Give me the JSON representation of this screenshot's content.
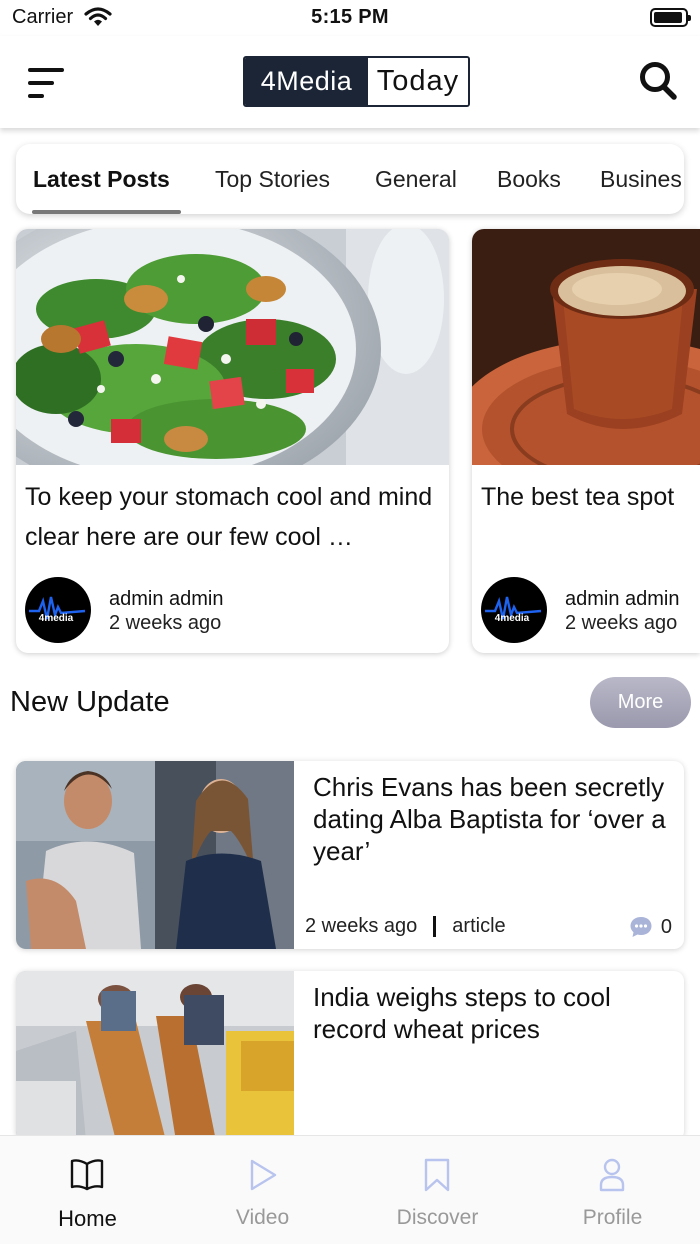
{
  "status": {
    "carrier": "Carrier",
    "time": "5:15 PM"
  },
  "header": {
    "logo_left": "4Media",
    "logo_right": "Today",
    "icons": [
      "menu-icon",
      "search-icon"
    ]
  },
  "tabs": [
    {
      "label": "Latest Posts",
      "active": true
    },
    {
      "label": "Top Stories"
    },
    {
      "label": "General"
    },
    {
      "label": "Books"
    },
    {
      "label": "Busines"
    }
  ],
  "featured": [
    {
      "title": "To keep your stomach cool and mind clear here are our few cool …",
      "author": "admin admin",
      "time": "2 weeks ago",
      "avatar_text": "4media",
      "image": "salad-photo"
    },
    {
      "title": "The best tea spot",
      "author": "admin admin",
      "time": "2 weeks ago",
      "avatar_text": "4media",
      "image": "tea-cup-photo"
    }
  ],
  "section": {
    "title": "New Update",
    "more_label": "More"
  },
  "updates": [
    {
      "title": "Chris Evans has been secretly dating Alba Baptista for ‘over a year’",
      "time": "2 weeks ago",
      "type": "article",
      "comments": "0",
      "image": "couple-photo"
    },
    {
      "title": "India weighs steps to cool record wheat prices",
      "image": "wheat-photo"
    }
  ],
  "nav": [
    {
      "label": "Home",
      "icon": "book-icon",
      "active": true
    },
    {
      "label": "Video",
      "icon": "play-icon"
    },
    {
      "label": "Discover",
      "icon": "bookmark-icon"
    },
    {
      "label": "Profile",
      "icon": "person-icon"
    }
  ],
  "colors": {
    "brand_dark": "#1c2536",
    "more_button": "#a9a8bb",
    "inactive_nav": "#999999",
    "inactive_nav_icon": "#b8c4ee"
  }
}
